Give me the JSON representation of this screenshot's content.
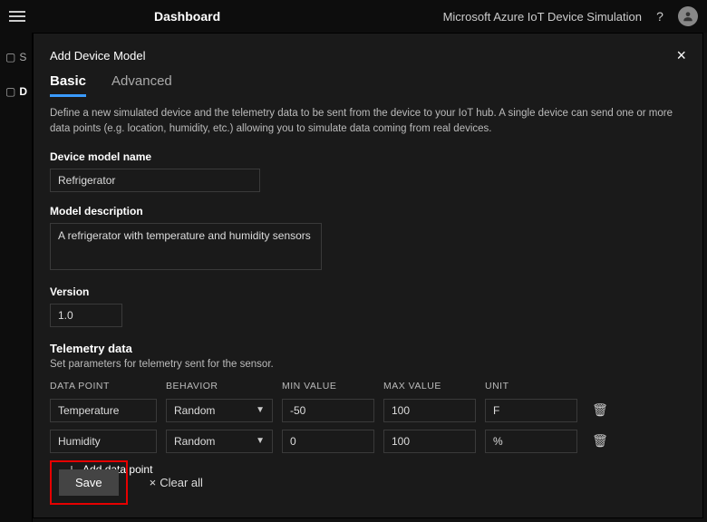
{
  "topbar": {
    "dashboard": "Dashboard",
    "product": "Microsoft Azure IoT Device Simulation",
    "help": "?"
  },
  "leftrail": {
    "item1": "S",
    "item2": "D"
  },
  "panel": {
    "title": "Add Device Model",
    "tabs": {
      "basic": "Basic",
      "advanced": "Advanced"
    },
    "description": "Define a new simulated device and the telemetry data to be sent from the device to your IoT hub. A single device can send one or more data points (e.g. location, humidity, etc.) allowing you to simulate data coming from real devices.",
    "fields": {
      "name_label": "Device model name",
      "name_value": "Refrigerator",
      "desc_label": "Model description",
      "desc_value": "A refrigerator with temperature and humidity sensors",
      "version_label": "Version",
      "version_value": "1.0"
    },
    "telemetry": {
      "heading": "Telemetry data",
      "subheading": "Set parameters for telemetry sent for the sensor.",
      "headers": {
        "dp": "DATA POINT",
        "bh": "BEHAVIOR",
        "min": "MIN VALUE",
        "max": "MAX VALUE",
        "unit": "UNIT"
      },
      "rows": [
        {
          "dp": "Temperature",
          "bh": "Random",
          "min": "-50",
          "max": "100",
          "unit": "F"
        },
        {
          "dp": "Humidity",
          "bh": "Random",
          "min": "0",
          "max": "100",
          "unit": "%"
        }
      ],
      "add": "Add data point"
    },
    "footer": {
      "save": "Save",
      "clear": "Clear all"
    }
  }
}
